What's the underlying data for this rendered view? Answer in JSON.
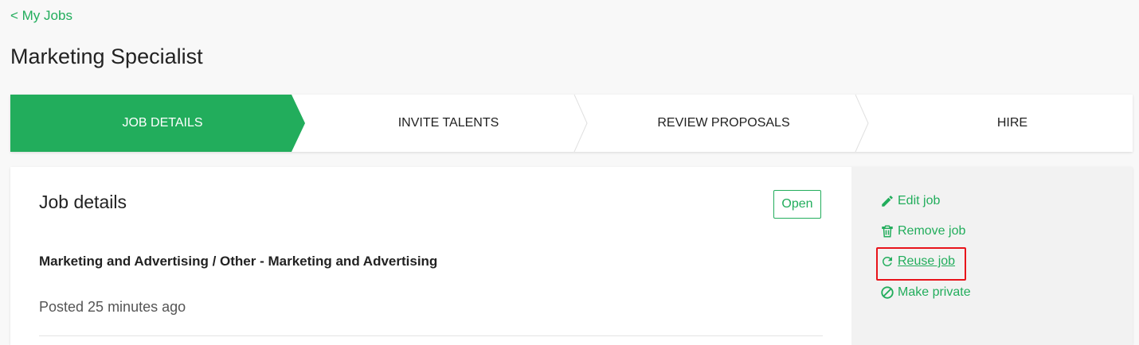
{
  "nav": {
    "back_label": "< My Jobs"
  },
  "page": {
    "title": "Marketing Specialist"
  },
  "stepper": {
    "steps": [
      {
        "label": "JOB DETAILS",
        "active": true
      },
      {
        "label": "INVITE TALENTS",
        "active": false
      },
      {
        "label": "REVIEW PROPOSALS",
        "active": false
      },
      {
        "label": "HIRE",
        "active": false
      }
    ]
  },
  "job": {
    "section_title": "Job details",
    "status": "Open",
    "category": "Marketing and Advertising / Other - Marketing and Advertising",
    "posted": "Posted 25 minutes ago"
  },
  "actions": {
    "edit": {
      "label": "Edit job",
      "icon": "pencil-icon"
    },
    "remove": {
      "label": "Remove job",
      "icon": "trash-icon"
    },
    "reuse": {
      "label": "Reuse job",
      "icon": "refresh-icon"
    },
    "private": {
      "label": "Make private",
      "icon": "ban-icon"
    }
  },
  "colors": {
    "accent": "#22ad5c",
    "highlight": "#e8141b",
    "background": "#f8f8f8",
    "side_panel": "#f2f2f2"
  }
}
